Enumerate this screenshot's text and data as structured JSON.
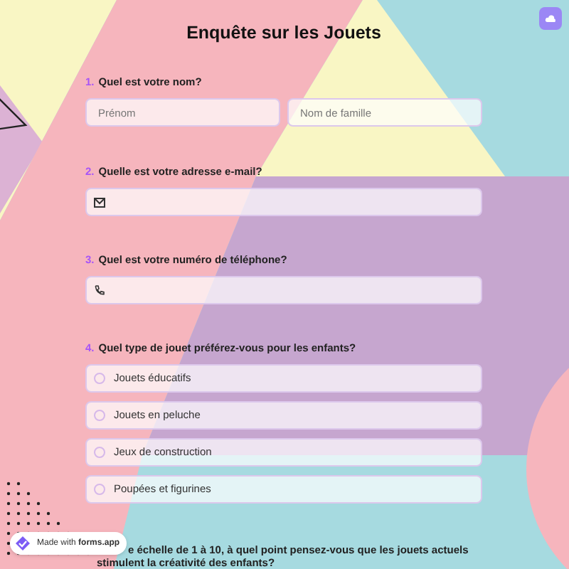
{
  "title": "Enquête sur les Jouets",
  "questions": [
    {
      "number": "1.",
      "text": "Quel est votre nom?",
      "kind": "name",
      "fields": [
        {
          "placeholder": "Prénom"
        },
        {
          "placeholder": "Nom de famille"
        }
      ]
    },
    {
      "number": "2.",
      "text": "Quelle est votre adresse e-mail?",
      "kind": "email"
    },
    {
      "number": "3.",
      "text": "Quel est votre numéro de téléphone?",
      "kind": "phone"
    },
    {
      "number": "4.",
      "text": "Quel type de jouet préférez-vous pour les enfants?",
      "kind": "choice",
      "options": [
        {
          "label": "Jouets éducatifs",
          "selected": false
        },
        {
          "label": "Jouets en peluche",
          "selected": false
        },
        {
          "label": "Jeux de construction",
          "selected": false
        },
        {
          "label": "Poupées et figurines",
          "selected": false
        }
      ]
    },
    {
      "lines": [
        "e échelle de 1 à 10, à quel point pensez-vous que les jouets actuels",
        "stimulent la créativité des enfants?"
      ],
      "kind": "scale"
    }
  ],
  "badge": {
    "prefix": "Made with",
    "brand": "forms.app"
  }
}
